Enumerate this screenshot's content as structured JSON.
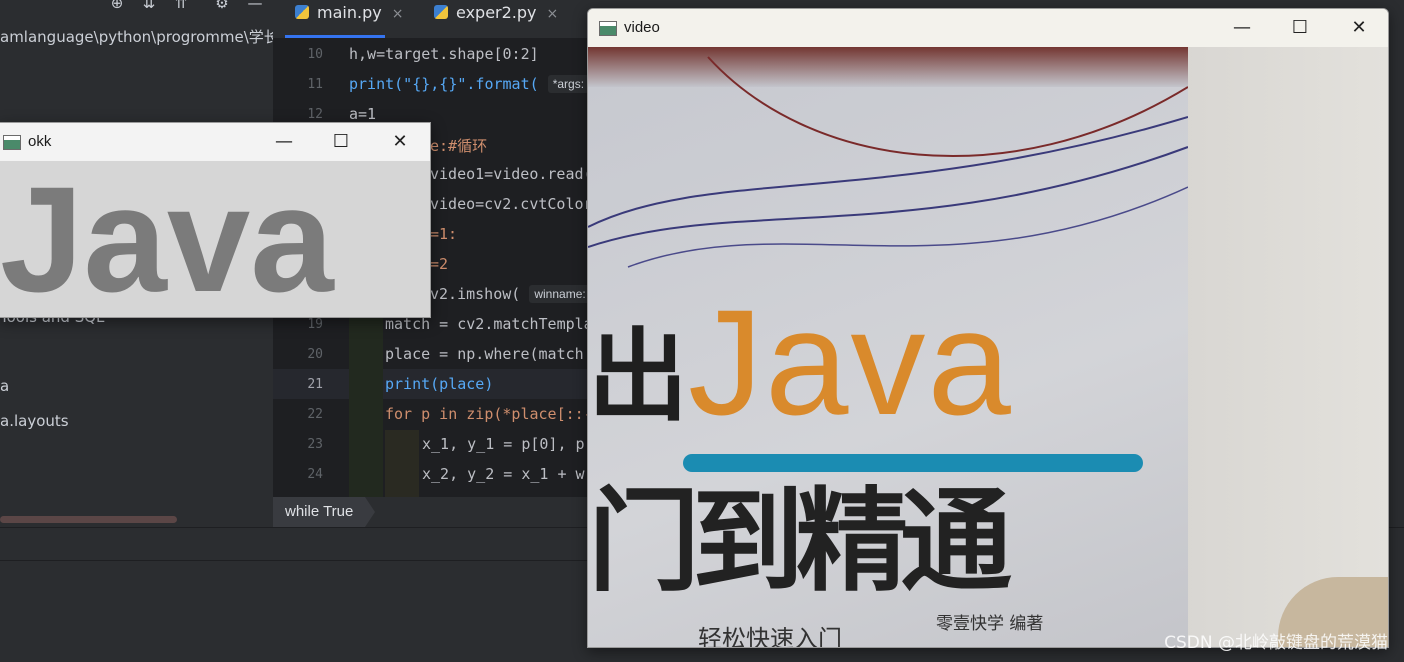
{
  "project": {
    "path": "amlanguage\\python\\progromme\\学长",
    "tree_items": [
      "Tools and SQL",
      "a",
      "a.layouts"
    ]
  },
  "editor": {
    "tabs": [
      {
        "label": "main.py",
        "close": "×"
      },
      {
        "label": "exper2.py",
        "close": "×"
      }
    ],
    "line_numbers": [
      "10",
      "11",
      "12",
      "19",
      "20",
      "21",
      "22",
      "23",
      "24"
    ],
    "code": {
      "l10": "h,w=target.shape[0:2]",
      "l11_pre": "print(\"{},{}\".format( ",
      "l11_hint": "*args:",
      "l12": "a=1",
      "l13": "e:#循环",
      "l14": "video1=video.read(",
      "l15": "video=cv2.cvtColor",
      "l16": "=1:",
      "l17": "=2",
      "l18_pre": "v2.imshow( ",
      "l18_hint": "winname:",
      "l19": "match = cv2.matchTempla",
      "l20": "place = np.where(match",
      "l21": "print(place)",
      "l22": "for p in zip(*place[::-",
      "l23": "x_1, y_1 = p[0], p[",
      "l24": "x_2, y_2 = x_1 + w,"
    },
    "breadcrumb": "while True"
  },
  "okk_window": {
    "title": "okk",
    "image_text": "Java"
  },
  "video_window": {
    "title": "video",
    "book": {
      "java": "Java",
      "chu": "出",
      "title": "门到精通",
      "subtitle": "轻松快速入门",
      "author": "零壹快学  编著"
    },
    "watermark": "CSDN @北岭敲键盘的荒漠猫"
  },
  "window_controls": {
    "minimize": "—",
    "maximize": "☐",
    "close": "✕"
  }
}
